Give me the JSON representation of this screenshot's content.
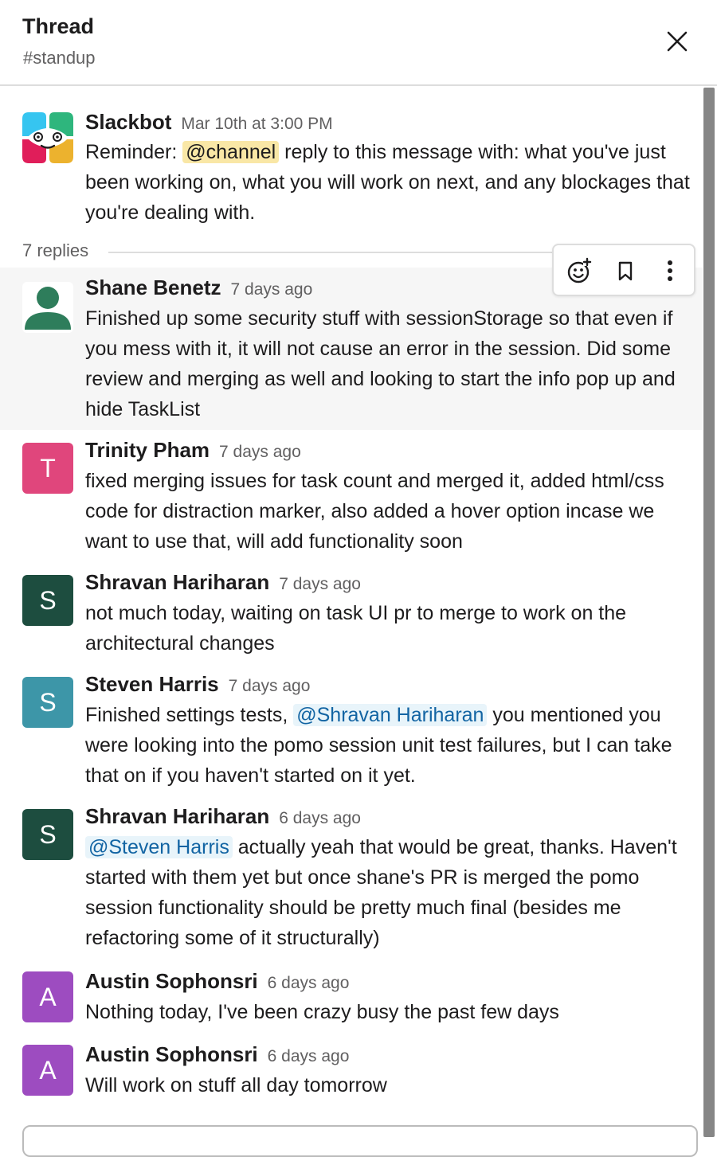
{
  "header": {
    "title": "Thread",
    "channel": "#standup"
  },
  "parent": {
    "author": "Slackbot",
    "time": "Mar 10th at 3:00 PM",
    "text_before": "Reminder: ",
    "mention": "@channel",
    "text_after": " reply to this message with: what you've just been working on, what you will work on next, and any blockages that you're dealing with."
  },
  "replies_label": "7 replies",
  "toolbar": {
    "icons": [
      "add-reaction-icon",
      "bookmark-icon",
      "more-actions-icon"
    ]
  },
  "replies": [
    {
      "author": "Shane Benetz",
      "time": "7 days ago",
      "avatar_letter": "",
      "avatar_color": "#2e7d5b",
      "text": "Finished up some security stuff with sessionStorage so that even if you mess with it, it will not cause an error in the session. Did some review and merging as well and looking to start the info pop up and hide TaskList"
    },
    {
      "author": "Trinity Pham",
      "time": "7 days ago",
      "avatar_letter": "T",
      "avatar_color": "#e0467c",
      "text": "fixed merging issues for task count and merged it, added html/css code for distraction marker, also added a hover option incase we want to use that, will add functionality soon"
    },
    {
      "author": "Shravan Hariharan",
      "time": "7 days ago",
      "avatar_letter": "S",
      "avatar_color": "#1d4d3f",
      "text": "not much today, waiting on task UI pr to merge to work on the architectural changes"
    },
    {
      "author": "Steven Harris",
      "time": "7 days ago",
      "avatar_letter": "S",
      "avatar_color": "#3d96a8",
      "text_before": "Finished settings tests, ",
      "mention": "@Shravan Hariharan",
      "text_after": " you mentioned you were looking into the pomo session unit test failures, but I can take that on if you haven't started on it yet."
    },
    {
      "author": "Shravan Hariharan",
      "time": "6 days ago",
      "avatar_letter": "S",
      "avatar_color": "#1d4d3f",
      "text_before": "",
      "mention": "@Steven Harris",
      "text_after": " actually yeah that would be great, thanks. Haven't started with them yet but once shane's PR is merged the pomo session functionality should be pretty much final (besides me refactoring some of it structurally)"
    },
    {
      "author": "Austin Sophonsri",
      "time": "6 days ago",
      "avatar_letter": "A",
      "avatar_color": "#9d4cc0",
      "text": "Nothing today, I've been crazy busy the past few days"
    },
    {
      "author": "Austin Sophonsri",
      "time": "6 days ago",
      "avatar_letter": "A",
      "avatar_color": "#9d4cc0",
      "text": "Will work on stuff all day tomorrow"
    }
  ]
}
